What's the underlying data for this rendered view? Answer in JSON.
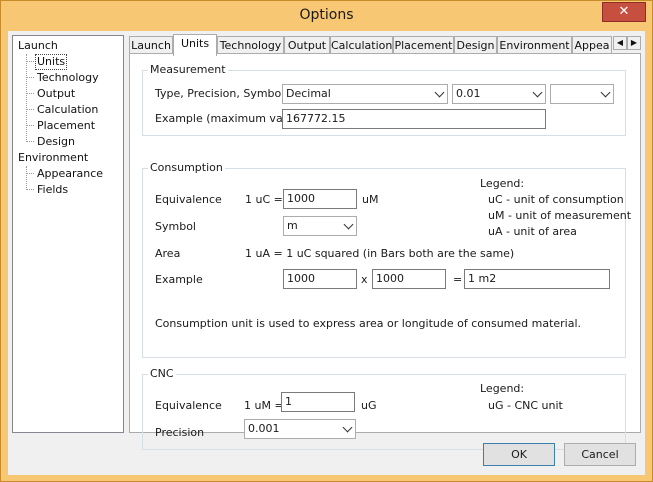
{
  "window": {
    "title": "Options",
    "close": "✕"
  },
  "tree": {
    "launch": "Launch",
    "units": "Units",
    "technology": "Technology",
    "output": "Output",
    "calculation": "Calculation",
    "placement": "Placement",
    "design": "Design",
    "environment": "Environment",
    "appearance": "Appearance",
    "fields": "Fields"
  },
  "tabs": [
    "Launch",
    "Units",
    "Technology",
    "Output",
    "Calculation",
    "Placement",
    "Design",
    "Environment",
    "Appea"
  ],
  "tab_scroll": {
    "left": "◀",
    "right": "▶"
  },
  "measurement": {
    "title": "Measurement",
    "type_label": "Type, Precision, Symbol",
    "type_value": "Decimal",
    "precision_value": "0.01",
    "symbol_value": "",
    "example_label": "Example (maximum value)",
    "example_value": "167772.15"
  },
  "consumption": {
    "title": "Consumption",
    "equivalence_label": "Equivalence",
    "equiv_prefix": "1 uC =",
    "equiv_value": "1000",
    "equiv_unit": "uM",
    "symbol_label": "Symbol",
    "symbol_value": "m",
    "area_label": "Area",
    "area_text": "1 uA = 1 uC squared (in Bars both are the same)",
    "example_label": "Example",
    "example_a": "1000",
    "times": "x",
    "example_b": "1000",
    "equals": "=",
    "example_result": "1 m2",
    "note": "Consumption unit is used to express area or longitude of consumed material.",
    "legend_title": "Legend:",
    "legend_1": "uC - unit of consumption",
    "legend_2": "uM - unit of measurement",
    "legend_3": "uA - unit of area"
  },
  "cnc": {
    "title": "CNC",
    "equivalence_label": "Equivalence",
    "equiv_prefix": "1 uM =",
    "equiv_value": "1",
    "equiv_unit": "uG",
    "precision_label": "Precision",
    "precision_value": "0.001",
    "legend_title": "Legend:",
    "legend_1": "uG - CNC unit"
  },
  "buttons": {
    "ok": "OK",
    "cancel": "Cancel"
  }
}
